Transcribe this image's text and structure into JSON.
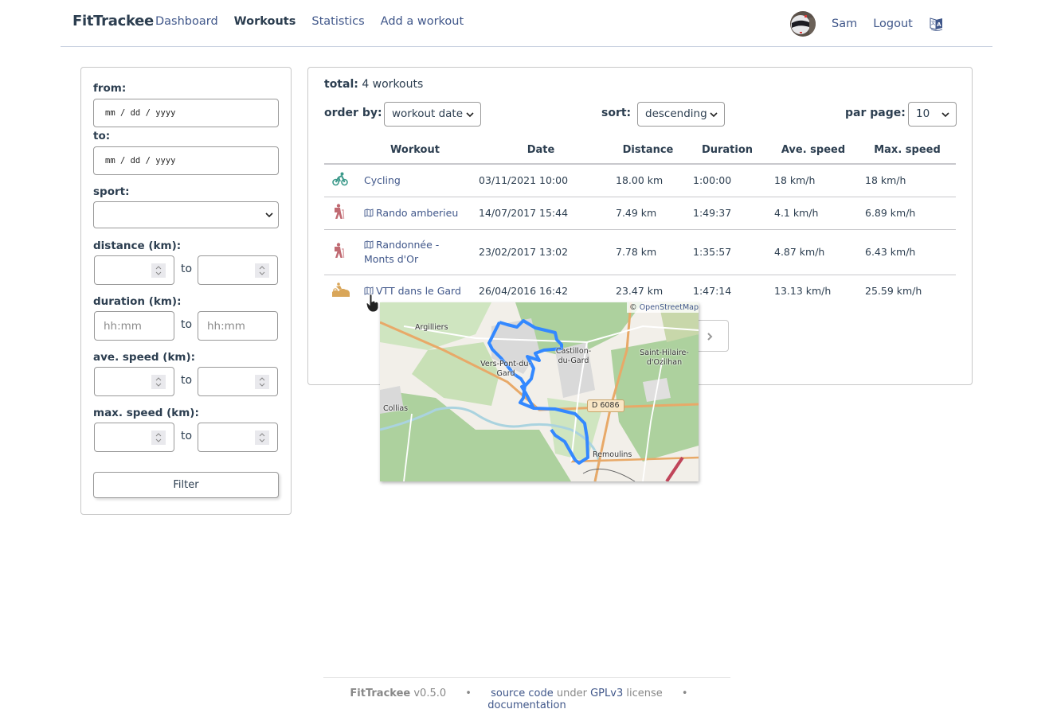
{
  "app": {
    "brand": "FitTrackee",
    "nav": [
      {
        "label": "Dashboard",
        "active": false
      },
      {
        "label": "Workouts",
        "active": true
      },
      {
        "label": "Statistics",
        "active": false
      },
      {
        "label": "Add a workout",
        "active": false
      }
    ],
    "user": "Sam",
    "logout": "Logout",
    "language_icon": "translate-icon"
  },
  "filters": {
    "from_label": "from:",
    "from_placeholder": "mm / dd / yyyy",
    "to_label": "to:",
    "to_placeholder": "mm / dd / yyyy",
    "sport_label": "sport:",
    "sport_value": "",
    "distance_label": "distance (km):",
    "duration_label": "duration (km):",
    "ave_speed_label": "ave. speed (km):",
    "max_speed_label": "max. speed (km):",
    "to_word": "to",
    "duration_placeholder": "hh:mm",
    "filter_button": "Filter"
  },
  "workouts": {
    "total_label": "total:",
    "total_value": "4 workouts",
    "order_by_label": "order by:",
    "order_by_value": "workout date",
    "sort_label": "sort:",
    "sort_value": "descending",
    "per_page_label": "par page:",
    "per_page_value": "10",
    "columns": [
      "Workout",
      "Date",
      "Distance",
      "Duration",
      "Ave. speed",
      "Max. speed"
    ],
    "rows": [
      {
        "sport": "cycling",
        "sport_color": "#3d9a8b",
        "title": "Cycling",
        "has_map": false,
        "date": "03/11/2021 10:00",
        "distance": "18.00 km",
        "duration": "1:00:00",
        "ave_speed": "18 km/h",
        "max_speed": "18 km/h"
      },
      {
        "sport": "hiking",
        "sport_color": "#c06a72",
        "title": "Rando amberieu",
        "has_map": true,
        "date": "14/07/2017 15:44",
        "distance": "7.49 km",
        "duration": "1:49:37",
        "ave_speed": "4.1 km/h",
        "max_speed": "6.89 km/h"
      },
      {
        "sport": "hiking",
        "sport_color": "#c06a72",
        "title": "Randonnée - Monts d'Or",
        "has_map": true,
        "date": "23/02/2017 13:02",
        "distance": "7.78 km",
        "duration": "1:35:57",
        "ave_speed": "4.87 km/h",
        "max_speed": "6.43 km/h"
      },
      {
        "sport": "mountain-biking",
        "sport_color": "#d9a659",
        "title": "VTT dans le Gard",
        "has_map": true,
        "date": "26/04/2016 16:42",
        "distance": "23.47 km",
        "duration": "1:47:14",
        "ave_speed": "13.13 km/h",
        "max_speed": "25.59 km/h"
      }
    ]
  },
  "map_popup": {
    "attribution_prefix": "©",
    "attribution_link": "OpenStreetMap",
    "places": [
      "Argilliers",
      "Vers-Pont-du-Gard",
      "Castillon-du-Gard",
      "Saint-Hilaire-d'Ozilhan",
      "Collias",
      "Remoulins"
    ],
    "road_label": "D 6086",
    "route_color": "#3388ff"
  },
  "footer": {
    "brand": "FitTrackee",
    "version": "v0.5.0",
    "sep": "•",
    "source_code": "source code",
    "under": "under",
    "license_link": "GPLv3",
    "license_word": "license",
    "documentation": "documentation"
  }
}
